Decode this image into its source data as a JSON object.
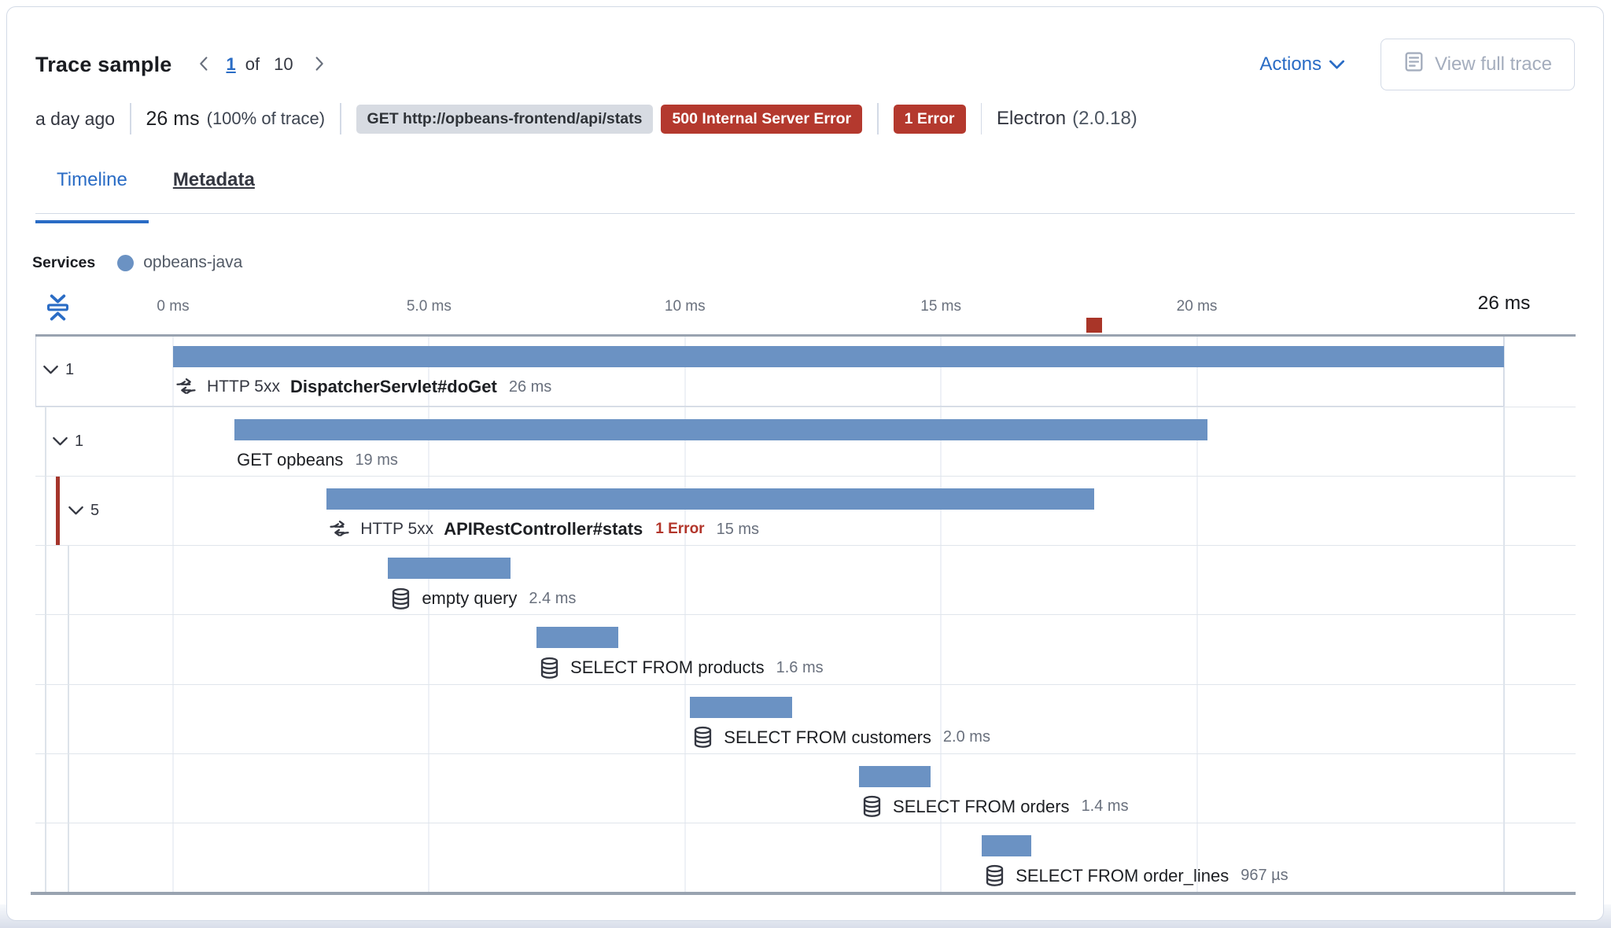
{
  "header": {
    "title": "Trace sample",
    "pager": {
      "current": "1",
      "of_label": "of",
      "total": "10"
    },
    "actions_label": "Actions",
    "view_full_trace_label": "View full trace"
  },
  "meta": {
    "age": "a day ago",
    "duration": "26 ms",
    "duration_pct": "(100% of trace)",
    "method_badge": "GET http://opbeans-frontend/api/stats",
    "status_badge": "500 Internal Server Error",
    "error_badge": "1 Error",
    "agent_name": "Electron",
    "agent_version": "(2.0.18)"
  },
  "tabs": [
    {
      "label": "Timeline",
      "active": true
    },
    {
      "label": "Metadata",
      "active": false
    }
  ],
  "legend": {
    "label": "Services",
    "items": [
      {
        "name": "opbeans-java",
        "color": "#6b92c3"
      }
    ]
  },
  "colors": {
    "bar": "#6b92c3",
    "error_marker": "#a93528",
    "error_accent": "#a5352b",
    "error_text": "#b2352a",
    "gridline": "#eef1f6",
    "gridline_end": "#dde3ec",
    "link": "#2a6cc5"
  },
  "chart_data": {
    "type": "waterfall",
    "title": "Trace timeline waterfall",
    "axis": {
      "unit": "ms",
      "min": 0,
      "max": 26,
      "ticks": [
        {
          "ms": 0,
          "label": "0 ms"
        },
        {
          "ms": 5,
          "label": "5.0 ms"
        },
        {
          "ms": 10,
          "label": "10 ms"
        },
        {
          "ms": 15,
          "label": "15 ms"
        },
        {
          "ms": 20,
          "label": "20 ms"
        },
        {
          "ms": 26,
          "label": "26 ms",
          "emphasis": true
        }
      ]
    },
    "error_marker_ms": 18,
    "items": [
      {
        "type": "transaction",
        "icon": "merge",
        "prefix": "HTTP 5xx",
        "name": "DispatcherServlet#doGet",
        "duration_label": "26 ms",
        "start_ms": 0,
        "duration_ms": 26,
        "toggle_count": "1",
        "indent": 0,
        "selected": true
      },
      {
        "type": "span",
        "icon": null,
        "prefix": null,
        "name": "GET opbeans",
        "duration_label": "19 ms",
        "start_ms": 1.2,
        "duration_ms": 19,
        "toggle_count": "1",
        "indent": 1
      },
      {
        "type": "transaction",
        "icon": "merge",
        "prefix": "HTTP 5xx",
        "name": "APIRestController#stats",
        "error_label": "1 Error",
        "duration_label": "15 ms",
        "start_ms": 3.0,
        "duration_ms": 15,
        "toggle_count": "5",
        "indent": 2,
        "error_accent": true
      },
      {
        "type": "span",
        "icon": "database",
        "prefix": null,
        "name": "empty query",
        "duration_label": "2.4 ms",
        "start_ms": 4.2,
        "duration_ms": 2.4,
        "indent": 3
      },
      {
        "type": "span",
        "icon": "database",
        "prefix": null,
        "name": "SELECT FROM products",
        "duration_label": "1.6 ms",
        "start_ms": 7.1,
        "duration_ms": 1.6,
        "indent": 3
      },
      {
        "type": "span",
        "icon": "database",
        "prefix": null,
        "name": "SELECT FROM customers",
        "duration_label": "2.0 ms",
        "start_ms": 10.1,
        "duration_ms": 2.0,
        "indent": 3
      },
      {
        "type": "span",
        "icon": "database",
        "prefix": null,
        "name": "SELECT FROM orders",
        "duration_label": "1.4 ms",
        "start_ms": 13.4,
        "duration_ms": 1.4,
        "indent": 3
      },
      {
        "type": "span",
        "icon": "database",
        "prefix": null,
        "name": "SELECT FROM order_lines",
        "duration_label": "967 µs",
        "start_ms": 15.8,
        "duration_ms": 0.97,
        "indent": 3
      }
    ]
  }
}
